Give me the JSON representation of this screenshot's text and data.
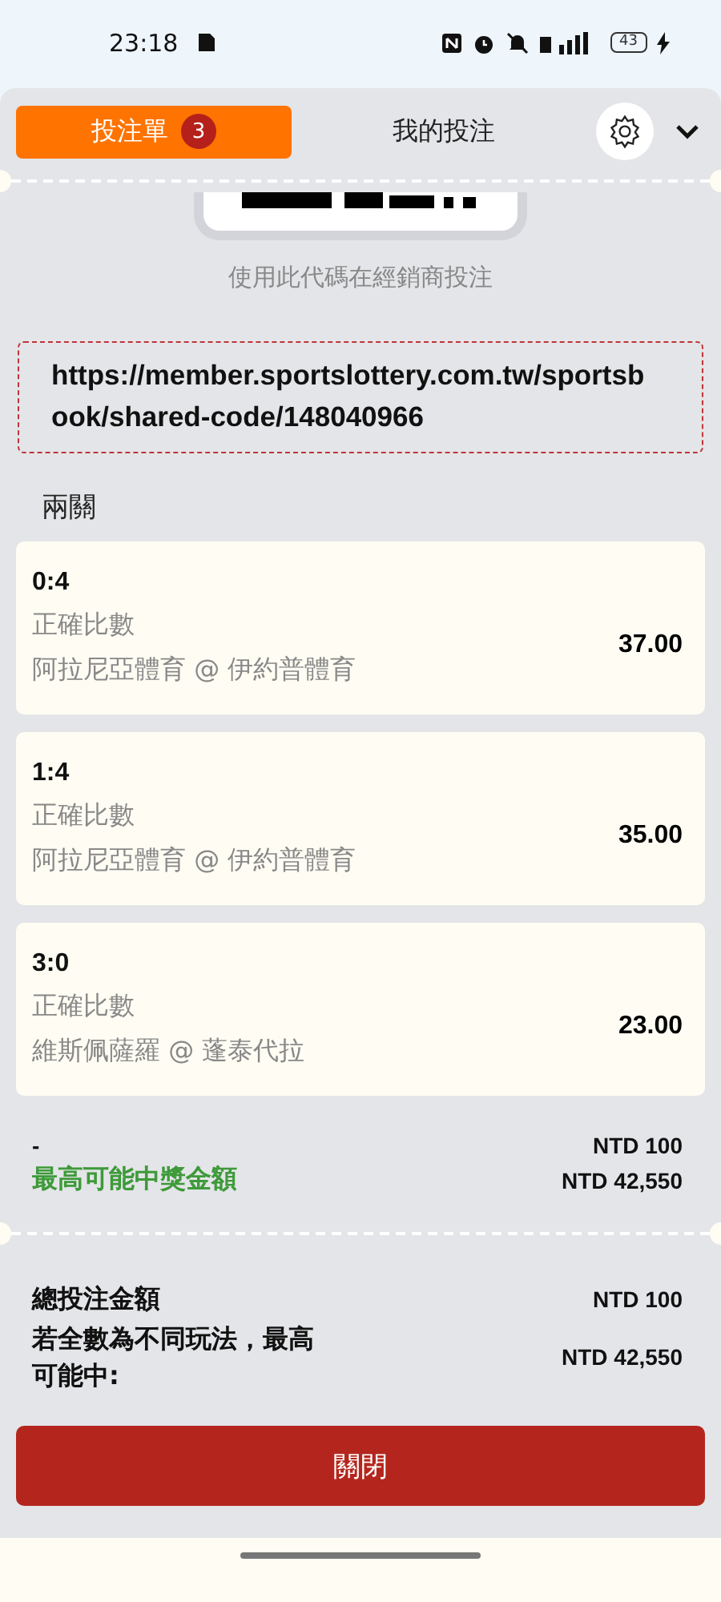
{
  "status_bar": {
    "time": "23:18",
    "battery": "43"
  },
  "tabs": [
    {
      "label": "投注單",
      "badge": "3",
      "selected": true
    },
    {
      "label": "我的投注",
      "selected": false
    }
  ],
  "share": {
    "caption": "使用此代碼在經銷商投注",
    "url": "https://member.sportslottery.com.tw/sportsbook/shared-code/148040966"
  },
  "bet_type": "兩關",
  "selections": [
    {
      "pick": "0:4",
      "market": "正確比數",
      "match": "阿拉尼亞體育 @ 伊約普體育",
      "odds": "37.00"
    },
    {
      "pick": "1:4",
      "market": "正確比數",
      "match": "阿拉尼亞體育 @ 伊約普體育",
      "odds": "35.00"
    },
    {
      "pick": "3:0",
      "market": "正確比數",
      "match": "維斯佩薩羅 @ 蓬泰代拉",
      "odds": "23.00"
    }
  ],
  "stake": {
    "label": "-",
    "value": "NTD 100"
  },
  "max_payout": {
    "label": "最高可能中獎金額",
    "value": "NTD 42,550"
  },
  "totals": [
    {
      "label": "總投注金額",
      "value": "NTD 100"
    },
    {
      "label": "若全數為不同玩法，最高可能中:",
      "value": "NTD 42,550"
    }
  ],
  "close_button": "關閉"
}
